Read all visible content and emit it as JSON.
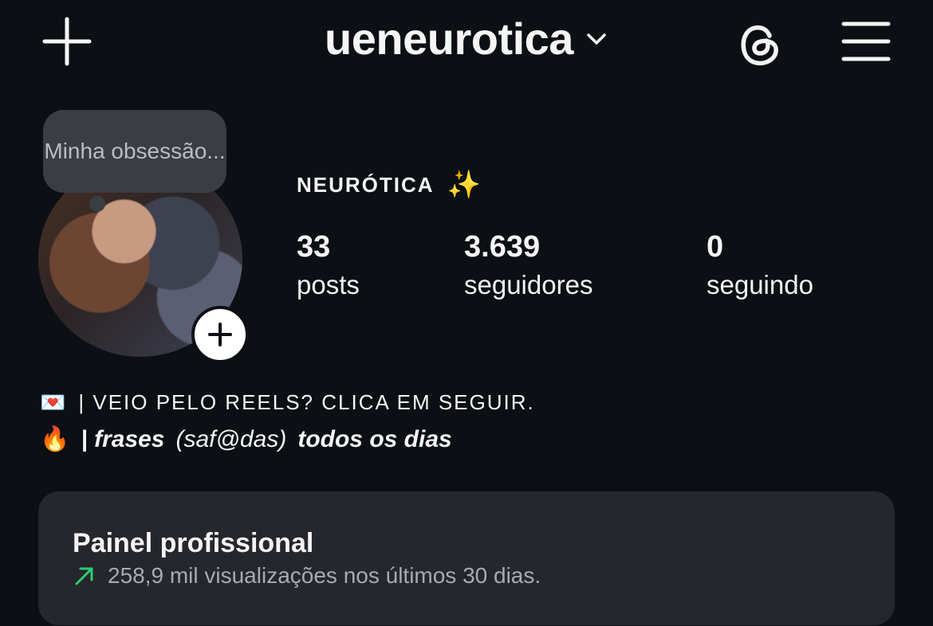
{
  "header": {
    "username": "ueneurotica",
    "icons": {
      "create": "plus-icon",
      "threads": "threads-icon",
      "menu": "hamburger-menu-icon",
      "switch": "chevron-down-icon"
    }
  },
  "profile": {
    "note_text": "Minha obsessão...",
    "display_name": "NEURÓTICA",
    "name_emoji": "✨",
    "avatar_icon": "profile-photo",
    "add_story_icon": "plus-icon"
  },
  "stats": {
    "posts": {
      "value": "33",
      "label": "posts"
    },
    "followers": {
      "value": "3.639",
      "label": "seguidores"
    },
    "following": {
      "value": "0",
      "label": "seguindo"
    }
  },
  "bio": {
    "line1_emoji": "💌",
    "line1_text": "| VEIO PELO REELS? CLICA EM SEGUIR.",
    "line2_emoji": "🔥",
    "line2_prefix": "| frases",
    "line2_paren": "(saf@das)",
    "line2_suffix": "todos os dias"
  },
  "professional_panel": {
    "title": "Painel profissional",
    "subtitle": "258,9 mil visualizações nos últimos 30 dias.",
    "trend_icon": "arrow-up-right-icon",
    "trend_color": "#2ecc71"
  },
  "colors": {
    "background": "#0c0f14",
    "panel": "#25272c",
    "note_bubble": "#3a3d43",
    "text": "#f5f5f5"
  }
}
